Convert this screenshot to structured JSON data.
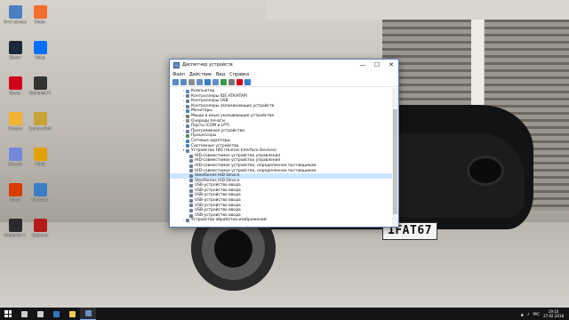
{
  "window": {
    "title": "Диспетчер устройств",
    "menu": [
      "Файл",
      "Действие",
      "Вид",
      "Справка"
    ],
    "minimize_glyph": "—",
    "maximize_glyph": "☐",
    "close_glyph": "✕",
    "toolbar_icons": [
      "back-icon",
      "forward-icon",
      "tree-view-icon",
      "properties-icon",
      "help-icon",
      "scan-hardware-icon",
      "update-driver-icon",
      "disable-icon",
      "uninstall-icon",
      "download-icon"
    ],
    "tree": [
      {
        "label": "Компьютер",
        "level": 0,
        "expanded": false,
        "icon_color": "#5b87c5"
      },
      {
        "label": "Контроллеры IDE ATA/ATAPI",
        "level": 0,
        "expanded": false,
        "icon_color": "#6d7f99"
      },
      {
        "label": "Контроллеры USB",
        "level": 0,
        "expanded": false,
        "icon_color": "#6d7f99"
      },
      {
        "label": "Контроллеры запоминающих устройств",
        "level": 0,
        "expanded": false,
        "icon_color": "#6d7f99"
      },
      {
        "label": "Мониторы",
        "level": 0,
        "expanded": false,
        "icon_color": "#4a7fc0"
      },
      {
        "label": "Мыши и иные указывающие устройства",
        "level": 0,
        "expanded": false,
        "icon_color": "#777777"
      },
      {
        "label": "Очереди печати",
        "level": 0,
        "expanded": false,
        "icon_color": "#8c8c8c"
      },
      {
        "label": "Порты (COM и LPT)",
        "level": 0,
        "expanded": false,
        "icon_color": "#6d7f99"
      },
      {
        "label": "Программные устройства",
        "level": 0,
        "expanded": false,
        "icon_color": "#6d7f99"
      },
      {
        "label": "Процессоры",
        "level": 0,
        "expanded": false,
        "icon_color": "#5a8a5a"
      },
      {
        "label": "Сетевые адаптеры",
        "level": 0,
        "expanded": false,
        "icon_color": "#4a7fc0"
      },
      {
        "label": "Системные устройства",
        "level": 0,
        "expanded": false,
        "icon_color": "#4a7fc0"
      },
      {
        "label": "Устройства HID (Human Interface Devices)",
        "level": 0,
        "expanded": true,
        "icon_color": "#6d7f99"
      },
      {
        "label": "HID-совместимое устройство управления",
        "level": 1,
        "icon_color": "#6d7f99"
      },
      {
        "label": "HID-совместимое устройство управления",
        "level": 1,
        "icon_color": "#6d7f99"
      },
      {
        "label": "HID-совместимое устройство, определенное поставщиком",
        "level": 1,
        "icon_color": "#6d7f99"
      },
      {
        "label": "HID-совместимое устройство, определенное поставщиком",
        "level": 1,
        "icon_color": "#6d7f99"
      },
      {
        "label": "SteelSeries HID Device",
        "level": 1,
        "icon_color": "#6d7f99",
        "selected": true
      },
      {
        "label": "SteelSeries HID Device",
        "level": 1,
        "icon_color": "#6d7f99"
      },
      {
        "label": "USB-устройство ввода",
        "level": 1,
        "icon_color": "#6d7f99"
      },
      {
        "label": "USB-устройство ввода",
        "level": 1,
        "icon_color": "#6d7f99"
      },
      {
        "label": "USB-устройство ввода",
        "level": 1,
        "icon_color": "#6d7f99"
      },
      {
        "label": "USB-устройство ввода",
        "level": 1,
        "icon_color": "#6d7f99"
      },
      {
        "label": "USB-устройство ввода",
        "level": 1,
        "icon_color": "#6d7f99"
      },
      {
        "label": "USB-устройство ввода",
        "level": 1,
        "icon_color": "#6d7f99"
      },
      {
        "label": "USB-устройство ввода",
        "level": 1,
        "icon_color": "#6d7f99"
      },
      {
        "label": "Устройства обработки изображений",
        "level": 0,
        "expanded": false,
        "icon_color": "#6d7f99"
      }
    ]
  },
  "wallpaper": {
    "plate_text": "1FAT67"
  },
  "desktop_icons": [
    {
      "label": "Этот компьютер",
      "color": "#4a7fc0"
    },
    {
      "label": "Steam",
      "color": "#1b2838"
    },
    {
      "label": "Opera",
      "color": "#d0021b"
    },
    {
      "label": "Chrome",
      "color": "#f2b233"
    },
    {
      "label": "Discord",
      "color": "#7289da"
    },
    {
      "label": "Office",
      "color": "#d83b01"
    },
    {
      "label": "Battlefield 1",
      "color": "#2a2a2a"
    },
    {
      "label": "Origin",
      "color": "#f56c2d"
    },
    {
      "label": "Uplay",
      "color": "#0070ff"
    },
    {
      "label": "Battlefield 4",
      "color": "#333333"
    },
    {
      "label": "Counter-Strike",
      "color": "#c9a23a"
    },
    {
      "label": "PUBG",
      "color": "#e0a100"
    },
    {
      "label": "Compass",
      "color": "#3b7dc4"
    },
    {
      "label": "Cuphead",
      "color": "#b31b1b"
    }
  ],
  "taskbar": {
    "items": [
      {
        "name": "search",
        "color": "#cccccc"
      },
      {
        "name": "task-view",
        "color": "#cccccc"
      },
      {
        "name": "edge",
        "color": "#3277bc"
      },
      {
        "name": "explorer",
        "color": "#f2c94c"
      },
      {
        "name": "device-manager",
        "color": "#6a8fc7",
        "active": true
      }
    ],
    "lang": "РУС",
    "time": "19:10",
    "date": "27.02.2018"
  }
}
